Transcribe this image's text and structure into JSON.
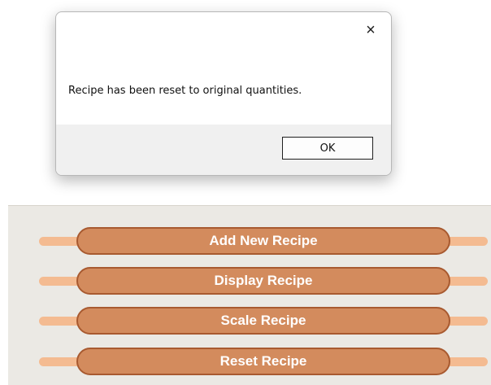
{
  "app": {
    "menu_buttons": [
      {
        "label": "Add New Recipe"
      },
      {
        "label": "Display Recipe"
      },
      {
        "label": "Scale Recipe"
      },
      {
        "label": "Reset Recipe"
      }
    ],
    "colors": {
      "button_fill": "#d38b5d",
      "button_border": "#a85a30",
      "handle": "#f4bb91",
      "panel_bg": "#ebe9e4"
    }
  },
  "dialog": {
    "message": "Recipe has been reset to original quantities.",
    "ok_label": "OK",
    "close_icon": "×"
  }
}
